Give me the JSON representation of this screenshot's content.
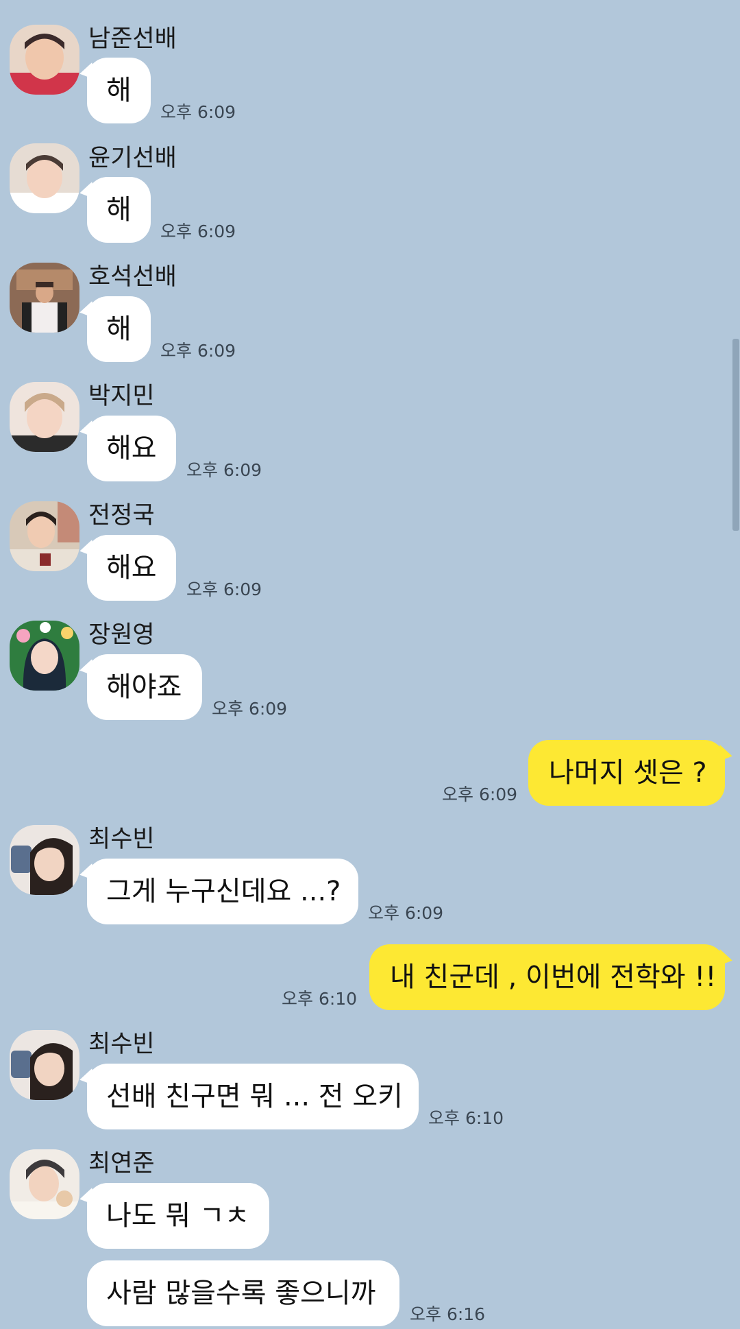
{
  "colors": {
    "background": "#b2c7da",
    "incoming_bubble": "#ffffff",
    "outgoing_bubble": "#fde833"
  },
  "messages": [
    {
      "sender": "남준선배",
      "text": "해",
      "time": "오후 6:09"
    },
    {
      "sender": "윤기선배",
      "text": "해",
      "time": "오후 6:09"
    },
    {
      "sender": "호석선배",
      "text": "해",
      "time": "오후 6:09"
    },
    {
      "sender": "박지민",
      "text": "해요",
      "time": "오후 6:09"
    },
    {
      "sender": "전정국",
      "text": "해요",
      "time": "오후 6:09"
    },
    {
      "sender": "장원영",
      "text": "해야죠",
      "time": "오후 6:09"
    },
    {
      "sender": "me",
      "text": "나머지 셋은 ?",
      "time": "오후 6:09"
    },
    {
      "sender": "최수빈",
      "text": "그게 누구신데요 ...?",
      "time": "오후 6:09"
    },
    {
      "sender": "me",
      "text": "내 친군데 , 이번에 전학와 !!",
      "time": "오후 6:10"
    },
    {
      "sender": "최수빈",
      "text": "선배 친구면 뭐 ... 전 오키",
      "time": "오후 6:10"
    },
    {
      "sender": "최연준",
      "text": "나도 뭐 ㄱㅊ",
      "time": ""
    },
    {
      "sender": "최연준",
      "text": "사람 많을수록 좋으니까",
      "time": "오후 6:16"
    }
  ]
}
